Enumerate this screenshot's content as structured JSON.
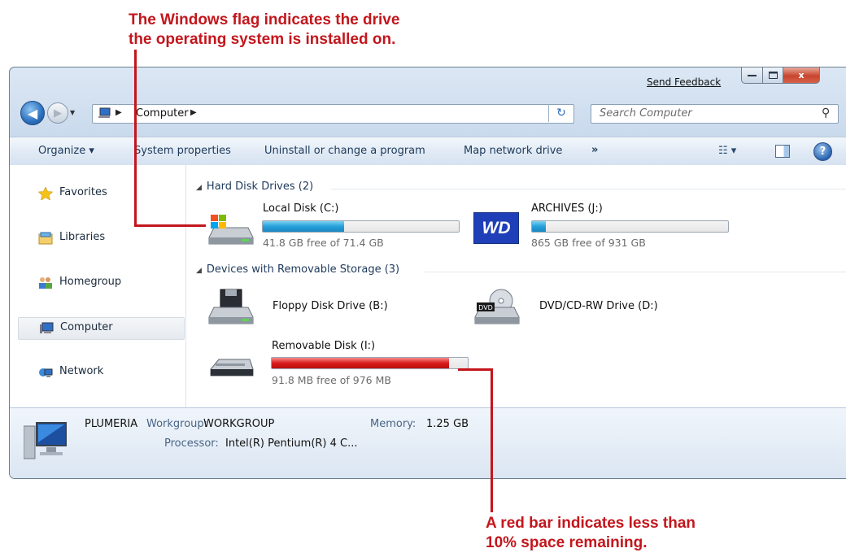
{
  "annotations": {
    "top_line1": "The Windows flag indicates the drive",
    "top_line2": "the operating system is installed on.",
    "bottom_line1": "A red bar indicates less than",
    "bottom_line2": "10% space remaining."
  },
  "titlebar": {
    "send_feedback": "Send Feedback",
    "close_glyph": "x"
  },
  "address": {
    "crumb": "Computer",
    "search_placeholder": "Search Computer"
  },
  "toolbar": {
    "organize": "Organize ▾",
    "system_properties": "System properties",
    "uninstall": "Uninstall or change a program",
    "map_drive": "Map network drive",
    "more": "»"
  },
  "nav": {
    "favorites": "Favorites",
    "libraries": "Libraries",
    "homegroup": "Homegroup",
    "computer": "Computer",
    "network": "Network"
  },
  "groups": {
    "hdd": "Hard Disk Drives (2)",
    "removable": "Devices with Removable Storage (3)"
  },
  "drives": {
    "c": {
      "name": "Local Disk (C:)",
      "free": "41.8 GB free of 71.4 GB",
      "used_fraction": 0.415,
      "bar_color": "#26a0da"
    },
    "j": {
      "name": "ARCHIVES (J:)",
      "free": "865 GB free of 931 GB",
      "used_fraction": 0.071,
      "bar_color": "#26a0da",
      "logo": "WD"
    },
    "b": {
      "name": "Floppy Disk Drive (B:)"
    },
    "d": {
      "name": "DVD/CD-RW Drive (D:)",
      "badge": "DVD"
    },
    "i": {
      "name": "Removable Disk (I:)",
      "free": "91.8 MB free of 976 MB",
      "used_fraction": 0.906,
      "bar_color": "#d91c1c"
    }
  },
  "details": {
    "computer_name": "PLUMERIA",
    "workgroup_label": "Workgroup:",
    "workgroup_value": "WORKGROUP",
    "memory_label": "Memory:",
    "memory_value": "1.25 GB",
    "processor_label": "Processor:",
    "processor_value": "Intel(R) Pentium(R) 4 C..."
  },
  "colors": {
    "callout": "#c3161c",
    "accent": "#1e395b"
  }
}
